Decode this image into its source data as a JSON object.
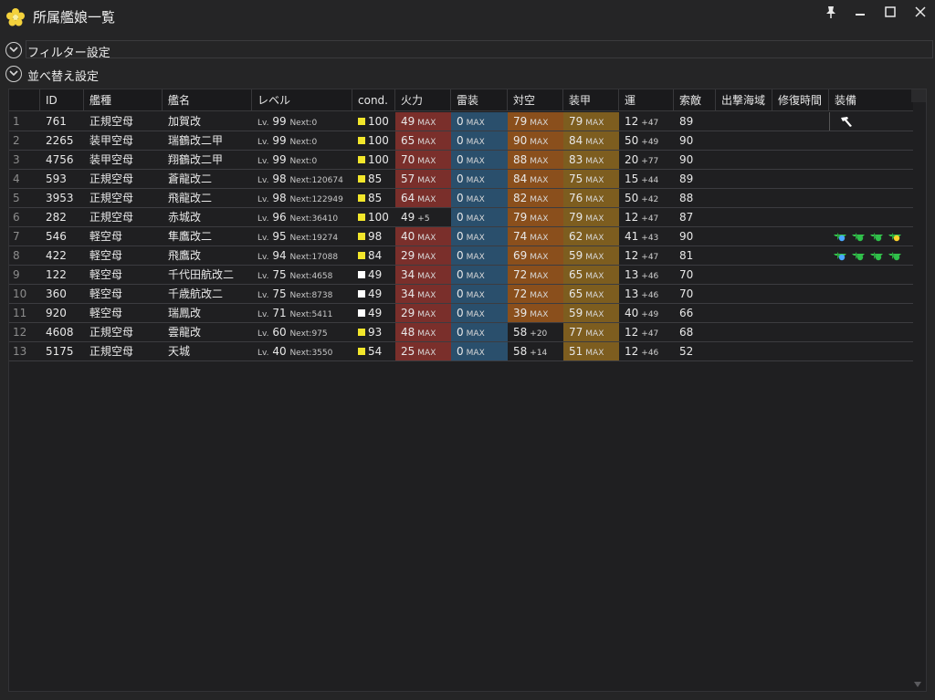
{
  "window": {
    "title": "所属艦娘一覧",
    "controls": [
      "pin",
      "minimize",
      "maximize",
      "close"
    ]
  },
  "sections": {
    "filter_label": "フィルター設定",
    "sort_label": "並べ替え設定"
  },
  "columns": {
    "no": "",
    "id": "ID",
    "type": "艦種",
    "name": "艦名",
    "level": "レベル",
    "cond": "cond.",
    "fire": "火力",
    "torpedo": "雷装",
    "aa": "対空",
    "armor": "装甲",
    "luck": "運",
    "los": "索敵",
    "sortie": "出撃海域",
    "repair": "修復時間",
    "equip": "装備"
  },
  "labels": {
    "lv": "Lv.",
    "next": "Next:",
    "max": "MAX"
  },
  "colors": {
    "fire": "#7a2f2b",
    "torpedo": "#2a4f6c",
    "aa": "#8a4f1c",
    "armor": "#7d5d1f",
    "cond_yellow": "#f2e62b",
    "cond_white": "#ffffff"
  },
  "rows": [
    {
      "no": "1",
      "id": "761",
      "type": "正規空母",
      "name": "加賀改",
      "lv": "99",
      "next": "0",
      "cond": "100",
      "cond_color": "yellow",
      "fire": "49",
      "fire_max": true,
      "fire_plus": "",
      "torp": "0",
      "aa": "79",
      "aa_max": true,
      "aa_plus": "",
      "armor": "79",
      "armor_max": true,
      "luck": "12",
      "luck_plus": "+47",
      "los": "89",
      "equip": "hammer-icon"
    },
    {
      "no": "2",
      "id": "2265",
      "type": "装甲空母",
      "name": "瑞鶴改二甲",
      "lv": "99",
      "next": "0",
      "cond": "100",
      "cond_color": "yellow",
      "fire": "65",
      "fire_max": true,
      "fire_plus": "",
      "torp": "0",
      "aa": "90",
      "aa_max": true,
      "aa_plus": "",
      "armor": "84",
      "armor_max": true,
      "luck": "50",
      "luck_plus": "+49",
      "los": "90",
      "equip": ""
    },
    {
      "no": "3",
      "id": "4756",
      "type": "装甲空母",
      "name": "翔鶴改二甲",
      "lv": "99",
      "next": "0",
      "cond": "100",
      "cond_color": "yellow",
      "fire": "70",
      "fire_max": true,
      "fire_plus": "",
      "torp": "0",
      "aa": "88",
      "aa_max": true,
      "aa_plus": "",
      "armor": "83",
      "armor_max": true,
      "luck": "20",
      "luck_plus": "+77",
      "los": "90",
      "equip": ""
    },
    {
      "no": "4",
      "id": "593",
      "type": "正規空母",
      "name": "蒼龍改二",
      "lv": "98",
      "next": "120674",
      "cond": "85",
      "cond_color": "yellow",
      "fire": "57",
      "fire_max": true,
      "fire_plus": "",
      "torp": "0",
      "aa": "84",
      "aa_max": true,
      "aa_plus": "",
      "armor": "75",
      "armor_max": true,
      "luck": "15",
      "luck_plus": "+44",
      "los": "89",
      "equip": ""
    },
    {
      "no": "5",
      "id": "3953",
      "type": "正規空母",
      "name": "飛龍改二",
      "lv": "98",
      "next": "122949",
      "cond": "85",
      "cond_color": "yellow",
      "fire": "64",
      "fire_max": true,
      "fire_plus": "",
      "torp": "0",
      "aa": "82",
      "aa_max": true,
      "aa_plus": "",
      "armor": "76",
      "armor_max": true,
      "luck": "50",
      "luck_plus": "+42",
      "los": "88",
      "equip": ""
    },
    {
      "no": "6",
      "id": "282",
      "type": "正規空母",
      "name": "赤城改",
      "lv": "96",
      "next": "36410",
      "cond": "100",
      "cond_color": "yellow",
      "fire": "49",
      "fire_max": false,
      "fire_plus": "+5",
      "torp": "0",
      "aa": "79",
      "aa_max": true,
      "aa_plus": "",
      "armor": "79",
      "armor_max": true,
      "luck": "12",
      "luck_plus": "+47",
      "los": "87",
      "equip": ""
    },
    {
      "no": "7",
      "id": "546",
      "type": "軽空母",
      "name": "隼鷹改二",
      "lv": "95",
      "next": "19274",
      "cond": "98",
      "cond_color": "yellow",
      "fire": "40",
      "fire_max": true,
      "fire_plus": "",
      "torp": "0",
      "aa": "74",
      "aa_max": true,
      "aa_plus": "",
      "armor": "62",
      "armor_max": true,
      "luck": "41",
      "luck_plus": "+43",
      "los": "90",
      "equip": "planes-a"
    },
    {
      "no": "8",
      "id": "422",
      "type": "軽空母",
      "name": "飛鷹改",
      "lv": "94",
      "next": "17088",
      "cond": "84",
      "cond_color": "yellow",
      "fire": "29",
      "fire_max": true,
      "fire_plus": "",
      "torp": "0",
      "aa": "69",
      "aa_max": true,
      "aa_plus": "",
      "armor": "59",
      "armor_max": true,
      "luck": "12",
      "luck_plus": "+47",
      "los": "81",
      "equip": "planes-b"
    },
    {
      "no": "9",
      "id": "122",
      "type": "軽空母",
      "name": "千代田航改二",
      "lv": "75",
      "next": "4658",
      "cond": "49",
      "cond_color": "white",
      "fire": "34",
      "fire_max": true,
      "fire_plus": "",
      "torp": "0",
      "aa": "72",
      "aa_max": true,
      "aa_plus": "",
      "armor": "65",
      "armor_max": true,
      "luck": "13",
      "luck_plus": "+46",
      "los": "70",
      "equip": ""
    },
    {
      "no": "10",
      "id": "360",
      "type": "軽空母",
      "name": "千歳航改二",
      "lv": "75",
      "next": "8738",
      "cond": "49",
      "cond_color": "white",
      "fire": "34",
      "fire_max": true,
      "fire_plus": "",
      "torp": "0",
      "aa": "72",
      "aa_max": true,
      "aa_plus": "",
      "armor": "65",
      "armor_max": true,
      "luck": "13",
      "luck_plus": "+46",
      "los": "70",
      "equip": ""
    },
    {
      "no": "11",
      "id": "920",
      "type": "軽空母",
      "name": "瑞鳳改",
      "lv": "71",
      "next": "5411",
      "cond": "49",
      "cond_color": "white",
      "fire": "29",
      "fire_max": true,
      "fire_plus": "",
      "torp": "0",
      "aa": "39",
      "aa_max": true,
      "aa_plus": "",
      "armor": "59",
      "armor_max": true,
      "luck": "40",
      "luck_plus": "+49",
      "los": "66",
      "equip": ""
    },
    {
      "no": "12",
      "id": "4608",
      "type": "正規空母",
      "name": "雲龍改",
      "lv": "60",
      "next": "975",
      "cond": "93",
      "cond_color": "yellow",
      "fire": "48",
      "fire_max": true,
      "fire_plus": "",
      "torp": "0",
      "aa": "58",
      "aa_max": false,
      "aa_plus": "+20",
      "armor": "77",
      "armor_max": true,
      "luck": "12",
      "luck_plus": "+47",
      "los": "68",
      "equip": ""
    },
    {
      "no": "13",
      "id": "5175",
      "type": "正規空母",
      "name": "天城",
      "lv": "40",
      "next": "3550",
      "cond": "54",
      "cond_color": "yellow",
      "fire": "25",
      "fire_max": true,
      "fire_plus": "",
      "torp": "0",
      "aa": "58",
      "aa_max": false,
      "aa_plus": "+14",
      "armor": "51",
      "armor_max": true,
      "luck": "12",
      "luck_plus": "+46",
      "los": "52",
      "equip": ""
    }
  ]
}
